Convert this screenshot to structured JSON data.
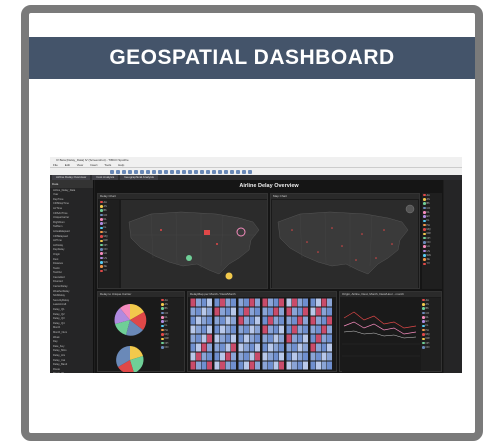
{
  "slide": {
    "title": "GEOSPATIAL DASHBOARD"
  },
  "app": {
    "window_title": "IV Beta [Delay_Data] IV (Screenshot) - TIBCO Spotfire",
    "menu": [
      "File",
      "Edit",
      "View",
      "Insert",
      "Tools",
      "Help"
    ],
    "tabs": [
      "Airline Delay Overview",
      "Cost Analysis",
      "Geographical Analysis"
    ],
    "dashboard_title": "Airline Delay Overview",
    "panels": {
      "delay_chart": "Delay Chart",
      "map_chart": "Map Chart",
      "delay_pie": "Delay to Unique Carrier",
      "delay_heatmap": "DelayMap per Month / Dest/Month",
      "line_chart": "Origin, Airline, Dest, Month, Dest/Hour - month"
    },
    "left_panel": {
      "header": "Data",
      "items": [
        "Airline_Delay_Data",
        "Year",
        "DepTime",
        "CRSDepTime",
        "ArrTime",
        "CRSArrTime",
        "UniqueCarrier",
        "FlightNum",
        "TailNum",
        "ActualElapsed",
        "CRSElapsed",
        "AirTime",
        "ArrDelay",
        "DepDelay",
        "Origin",
        "Dest",
        "Distance",
        "TaxiIn",
        "TaxiOut",
        "Cancelled",
        "Diverted",
        "CarrierDelay",
        "WeatherDelay",
        "NASDelay",
        "SecurityDelay",
        "LateAircraft",
        "Delay_Q1",
        "Delay_Q2",
        "Delay_Q3",
        "Delay_Q4",
        "Month",
        "Month_Num",
        "Week",
        "Day",
        "Date_Key",
        "Delay_Mins",
        "Delay_Hrs",
        "Delay_Cat",
        "Delay_Band",
        "Route",
        "Route_ID"
      ]
    },
    "legend_carriers": [
      "AA",
      "AS",
      "B6",
      "CO",
      "DL",
      "EV",
      "FL",
      "HA",
      "MQ",
      "NW",
      "OH",
      "OO",
      "UA",
      "US",
      "WN",
      "XE",
      "YV"
    ]
  },
  "colors": {
    "banner": "#44546a",
    "frame": "#7a7a7a",
    "app_bg": "#1e1e1e",
    "map_land": "#3a3a3a",
    "accent_red": "#e04848",
    "accent_yellow": "#f2c94c",
    "accent_green": "#6fcf97",
    "accent_pink": "#f58bbd"
  }
}
